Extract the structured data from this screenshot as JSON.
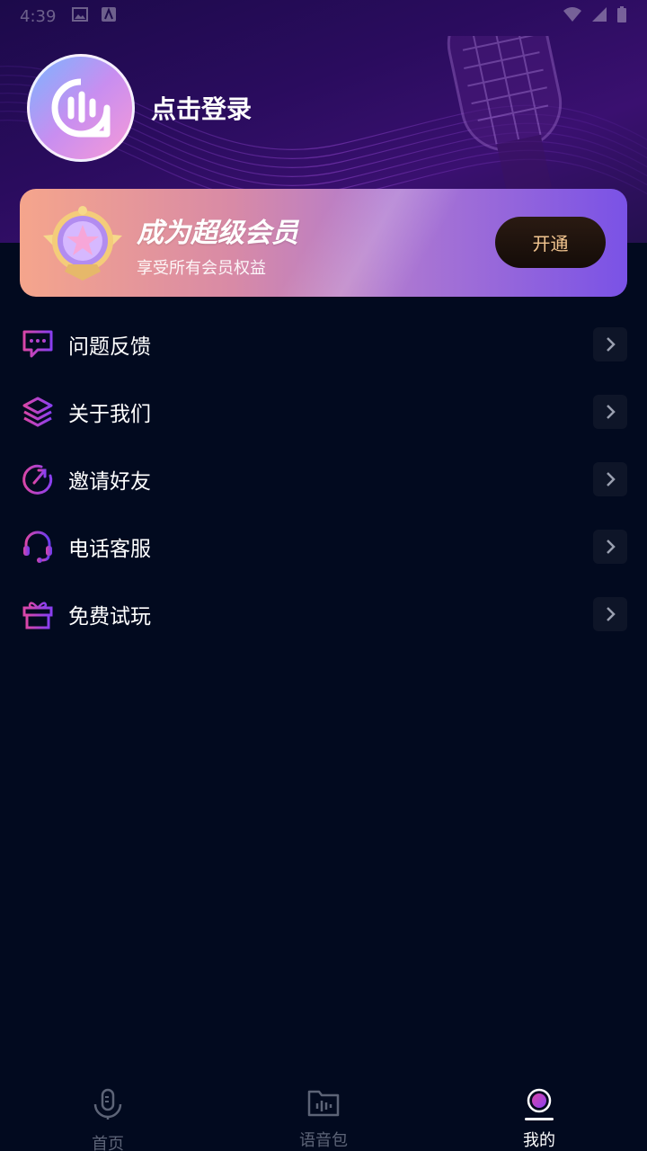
{
  "status_bar": {
    "time": "4:39",
    "icons": [
      "image-icon",
      "a-icon",
      "wifi-icon",
      "signal-icon",
      "battery-icon"
    ]
  },
  "profile": {
    "login_label": "点击登录"
  },
  "vip": {
    "title": "成为超级会员",
    "subtitle": "享受所有会员权益",
    "button_label": "开通"
  },
  "menu": {
    "items": [
      {
        "label": "问题反馈",
        "icon": "feedback-icon"
      },
      {
        "label": "关于我们",
        "icon": "layers-icon"
      },
      {
        "label": "邀请好友",
        "icon": "share-arrow-icon"
      },
      {
        "label": "电话客服",
        "icon": "headset-icon"
      },
      {
        "label": "免费试玩",
        "icon": "gift-icon"
      }
    ]
  },
  "tabbar": {
    "tabs": [
      {
        "label": "首页",
        "icon": "microphone-icon",
        "active": false
      },
      {
        "label": "语音包",
        "icon": "folder-audio-icon",
        "active": false
      },
      {
        "label": "我的",
        "icon": "profile-dot-icon",
        "active": true
      }
    ]
  },
  "colors": {
    "background": "#020a1f",
    "accent_purple": "#8a3ff0",
    "accent_pink": "#d946a8",
    "vip_button_text": "#f3c690",
    "tab_inactive": "#5d6477"
  }
}
